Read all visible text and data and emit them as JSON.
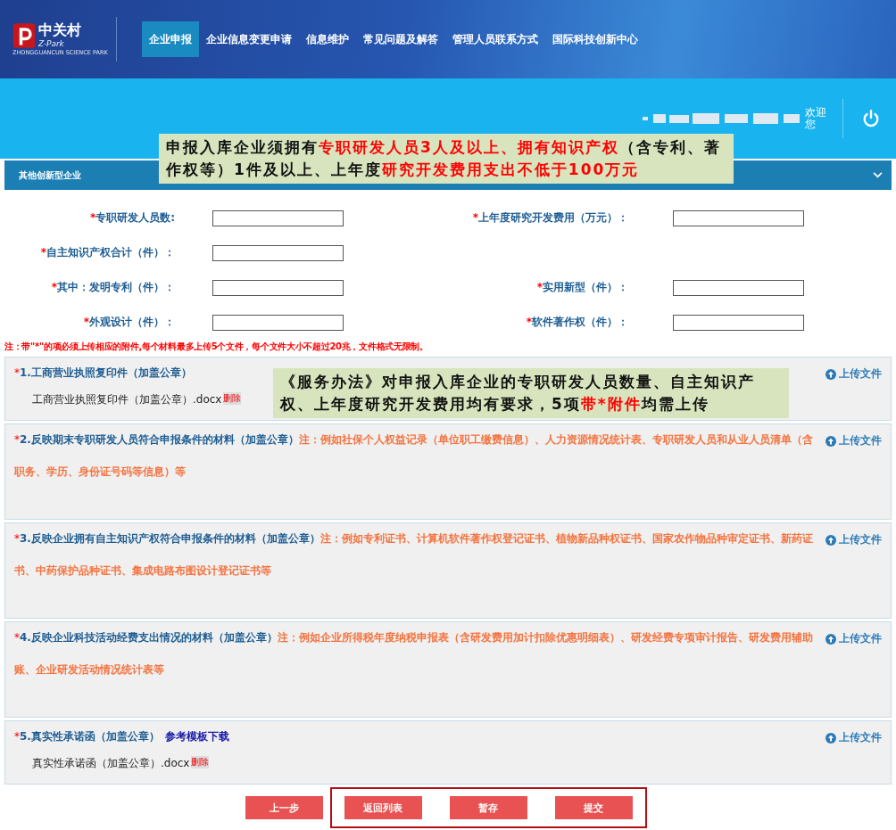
{
  "logo": {
    "name": "中关村",
    "brand": "Z-Park",
    "subtitle": "ZHONGGUANCUN SCIENCE PARK"
  },
  "nav": [
    {
      "label": "企业申报",
      "selected": true
    },
    {
      "label": "企业信息变更申请",
      "selected": false
    },
    {
      "label": "信息维护",
      "selected": false
    },
    {
      "label": "常见问题及解答",
      "selected": false
    },
    {
      "label": "管理人员联系方式",
      "selected": false
    },
    {
      "label": "国际科技创新中心",
      "selected": false
    }
  ],
  "user": {
    "greeting": "欢迎您"
  },
  "callouts": [
    {
      "segments": [
        {
          "text": "申报入库企业须拥有",
          "emphasis": false
        },
        {
          "text": "专职研发人员3人及以上、拥有知识产权",
          "emphasis": true
        },
        {
          "text": "（含专利、著作权等）1件及以上、上年度",
          "emphasis": false
        },
        {
          "text": "研究开发费用支出不低于100万元",
          "emphasis": true
        }
      ]
    },
    {
      "segments": [
        {
          "text": "《服务办法》对申报入库企业的专职研发人员数量、自主知识产权、上年度研究开发费用均有要求，5项",
          "emphasis": false
        },
        {
          "text": "带*附件",
          "emphasis": true
        },
        {
          "text": "均需上传",
          "emphasis": false
        }
      ]
    }
  ],
  "section": {
    "title": "其他创新型企业",
    "expanded": true
  },
  "form_rows": [
    {
      "left": {
        "marker": "*",
        "label": "专职研发人员数:"
      },
      "right": {
        "marker": "*",
        "label": "上年度研究开发费用（万元）："
      }
    },
    {
      "left": {
        "marker": "*",
        "label": "自主知识产权合计（件）："
      }
    },
    {
      "left": {
        "marker": "*",
        "label": "其中：发明专利（件）："
      },
      "right": {
        "marker": "*",
        "label": "实用新型（件）："
      }
    },
    {
      "left": {
        "marker": "*",
        "label": "外观设计（件）："
      },
      "right": {
        "marker": "*",
        "label": "软件著作权（件）："
      }
    }
  ],
  "notice": "注：带\"*\"的项必须上传相应的附件,每个材料最多上传5个文件，每个文件大小不超过20兆，文件格式无限制。",
  "attachments": [
    {
      "marker": "*",
      "title": "1.工商营业执照复印件（加盖公章）",
      "files": [
        {
          "name": "工商营业执照复印件（加盖公章）.docx",
          "action": "删除"
        }
      ],
      "upload": "上传文件"
    },
    {
      "marker": "*",
      "title": "2.反映期末专职研发人员符合申报条件的材料（加盖公章）",
      "note": "注：例如社保个人权益记录（单位职工缴费信息）、人力资源情况统计表、专职研发人员和从业人员清单（含职务、学历、身份证号码等信息）等",
      "upload": "上传文件"
    },
    {
      "marker": "*",
      "title": "3.反映企业拥有自主知识产权符合申报条件的材料（加盖公章）",
      "note": "注：例如专利证书、计算机软件著作权登记证书、植物新品种权证书、国家农作物品种审定证书、新药证书、中药保护品种证书、集成电路布图设计登记证书等",
      "upload": "上传文件"
    },
    {
      "marker": "*",
      "title": "4.反映企业科技活动经费支出情况的材料（加盖公章）",
      "note": "注：例如企业所得税年度纳税申报表（含研发费用加计扣除优惠明细表）、研发经费专项审计报告、研发费用辅助账、企业研发活动情况统计表等",
      "upload": "上传文件"
    },
    {
      "marker": "*",
      "title": "5.真实性承诺函（加盖公章）",
      "link": "参考模板下载",
      "files": [
        {
          "name": "真实性承诺函（加盖公章）.docx",
          "action": "删除"
        }
      ],
      "upload": "上传文件"
    }
  ],
  "buttons": [
    "上一步"
  ],
  "highlighted_buttons": [
    "返回列表",
    "暂存",
    "提交"
  ]
}
